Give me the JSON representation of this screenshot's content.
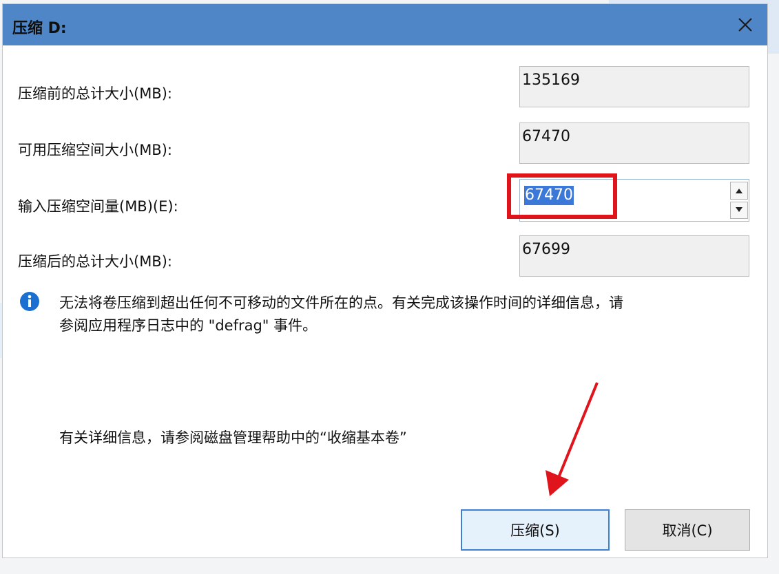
{
  "dialog": {
    "title": "压缩 D:",
    "close_glyph": "close-icon"
  },
  "fields": {
    "total_before_label": "压缩前的总计大小(MB):",
    "total_before_value": "135169",
    "available_label": "可用压缩空间大小(MB):",
    "available_value": "67470",
    "input_label": "输入压缩空间量(MB)(E):",
    "input_value": "67470",
    "total_after_label": "压缩后的总计大小(MB):",
    "total_after_value": "67699"
  },
  "info": {
    "icon": "info-icon",
    "line1": "无法将卷压缩到超出任何不可移动的文件所在的点。有关完成该操作时间的详细信息，请",
    "line2": "参阅应用程序日志中的 \"defrag\" 事件。"
  },
  "help_text": "有关详细信息，请参阅磁盘管理帮助中的“收缩基本卷”",
  "buttons": {
    "ok_label": "压缩(S)",
    "cancel_label": "取消(C)"
  },
  "colors": {
    "titlebar": "#4f86c7",
    "highlight": "#e0141b",
    "selection": "#3b78d8",
    "info_icon": "#1a6fd0"
  }
}
